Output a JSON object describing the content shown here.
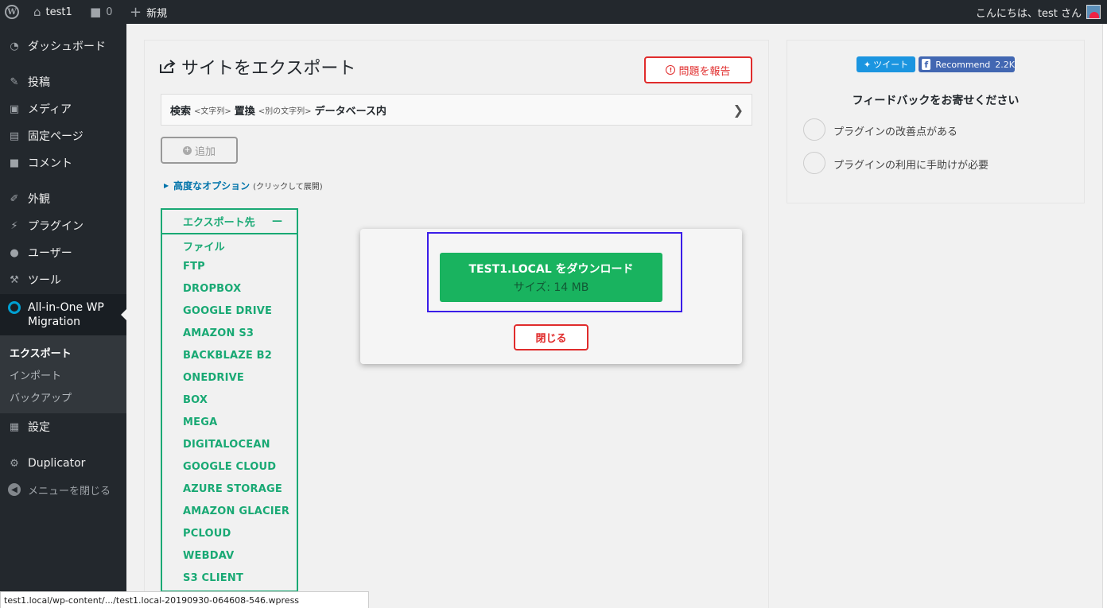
{
  "adminbar": {
    "site_name": "test1",
    "comments_count": "0",
    "new_label": "新規",
    "greeting": "こんにちは、test さん"
  },
  "sidebar": {
    "items": [
      {
        "label": "ダッシュボード",
        "icon": "dashboard-icon"
      },
      {
        "label": "投稿",
        "icon": "pin-icon"
      },
      {
        "label": "メディア",
        "icon": "media-icon"
      },
      {
        "label": "固定ページ",
        "icon": "page-icon"
      },
      {
        "label": "コメント",
        "icon": "comment-icon"
      },
      {
        "label": "外観",
        "icon": "brush-icon"
      },
      {
        "label": "プラグイン",
        "icon": "plugin-icon"
      },
      {
        "label": "ユーザー",
        "icon": "user-icon"
      },
      {
        "label": "ツール",
        "icon": "wrench-icon"
      },
      {
        "label": "All-in-One WP Migration",
        "icon": "ai1wm-icon"
      },
      {
        "label": "設定",
        "icon": "settings-icon"
      },
      {
        "label": "Duplicator",
        "icon": "duplicator-icon"
      },
      {
        "label": "メニューを閉じる",
        "icon": "collapse-icon"
      }
    ],
    "submenu": [
      "エクスポート",
      "インポート",
      "バックアップ"
    ]
  },
  "main": {
    "title": "サイトをエクスポート",
    "report_button": "問題を報告",
    "search_replace": {
      "search": "検索",
      "search_hint": "<文字列>",
      "replace": "置換",
      "replace_hint": "<別の文字列>",
      "suffix": "データベース内"
    },
    "add_button": "追加",
    "advanced_options": "高度なオプション",
    "advanced_hint": "(クリックして展開)",
    "export_to": {
      "label": "エクスポート先",
      "collapse": "—",
      "options": [
        "ファイル",
        "FTP",
        "DROPBOX",
        "GOOGLE DRIVE",
        "AMAZON S3",
        "BACKBLAZE B2",
        "ONEDRIVE",
        "BOX",
        "MEGA",
        "DIGITALOCEAN",
        "GOOGLE CLOUD",
        "AZURE STORAGE",
        "AMAZON GLACIER",
        "PCLOUD",
        "WEBDAV",
        "S3 CLIENT"
      ]
    }
  },
  "right": {
    "tweet": "ツイート",
    "fb_recommend": "Recommend",
    "fb_count": "2.2K",
    "feedback_title": "フィードバックをお寄せください",
    "feedback_options": [
      "プラグインの改善点がある",
      "プラグインの利用に手助けが必要"
    ]
  },
  "modal": {
    "download_line1": "TEST1.LOCAL をダウンロード",
    "download_line2": "サイズ: 14 MB",
    "close": "閉じる"
  },
  "status_bar": "test1.local/wp-content/.../test1.local-20190930-064608-546.wpress",
  "colors": {
    "admin_bg": "#23282d",
    "accent_green": "#19a974",
    "download_green": "#19b35f",
    "danger_red": "#e02c2c",
    "highlight_blue": "#3a1de8"
  }
}
